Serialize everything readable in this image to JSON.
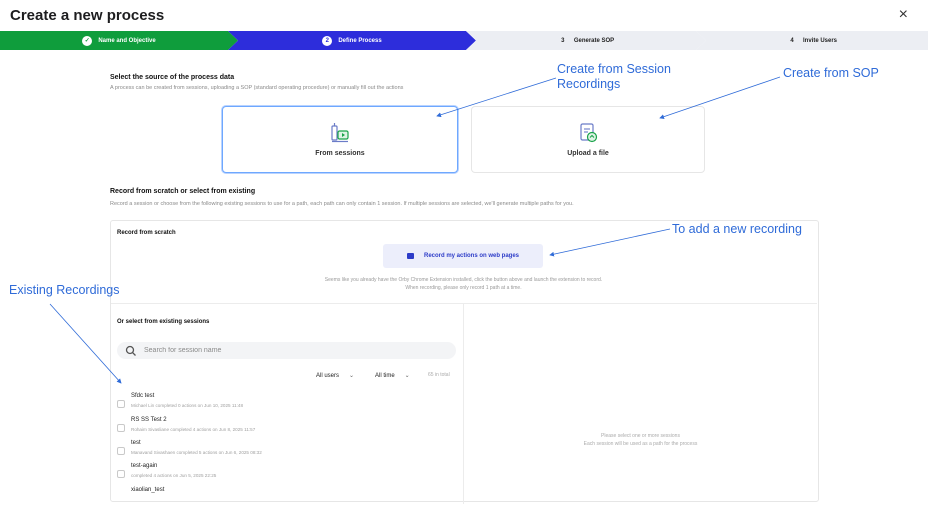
{
  "title": "Create a new process",
  "close_icon": "×",
  "steps": [
    {
      "num": "✓",
      "label": "Name and Objective"
    },
    {
      "num": "2",
      "label": "Define Process"
    },
    {
      "num": "3",
      "label": "Generate SOP"
    },
    {
      "num": "4",
      "label": "Invite Users"
    }
  ],
  "source": {
    "title": "Select the source of the process data",
    "desc": "A process can be created from sessions, uploading a SOP (standard operating procedure) or manually fill out the actions",
    "options": [
      {
        "label": "From sessions",
        "icon": "sessions-icon",
        "selected": true
      },
      {
        "label": "Upload a file",
        "icon": "upload-file-icon",
        "selected": false
      }
    ]
  },
  "record": {
    "title": "Record from scratch or select from existing",
    "desc": "Record a session or choose from the following existing sessions to use for a path, each path can only contain 1 session. If multiple sessions are selected, we'll generate multiple paths for you.",
    "scratch_title": "Record from scratch",
    "button_label": "Record my actions on web pages",
    "note_line1": "Seems like you already have the Orby Chrome Extension installed, click the button above and launch the extension to record.",
    "note_line2": "When recording, please only record 1 path at a time."
  },
  "existing": {
    "title": "Or select from existing sessions",
    "search_placeholder": "Search for session name",
    "filter_users": "All users",
    "filter_time": "All time",
    "count": "65 in total",
    "sessions": [
      {
        "name": "Sfdc test",
        "sub": "Michael Lin completed 0 actions on Jun 10, 2025 11:48"
      },
      {
        "name": "RS SS Test 2",
        "sub": "Rohaim Sivasliane completed 4 actions on Jun 8, 2025 11:57"
      },
      {
        "name": "test",
        "sub": "Manavand Sivashaen completed 5 actions on Jun 6, 2025 08:32"
      },
      {
        "name": "test-again",
        "sub": "completed 4 actions on Jun 5, 2025 22:25"
      },
      {
        "name": "xiaolian_test",
        "sub": ""
      }
    ],
    "empty_line1": "Please select one or more sessions",
    "empty_line2": "Each session will be used as a path for the process"
  },
  "annotations": {
    "session_recordings": "Create from Session Recordings",
    "sop": "Create from SOP",
    "new_recording": "To add a new recording",
    "existing_recordings": "Existing Recordings"
  },
  "colors": {
    "step_done": "#0f9d3c",
    "step_active": "#2d2ddb",
    "step_pending": "#eceef3",
    "annotation": "#2f6bd8"
  }
}
